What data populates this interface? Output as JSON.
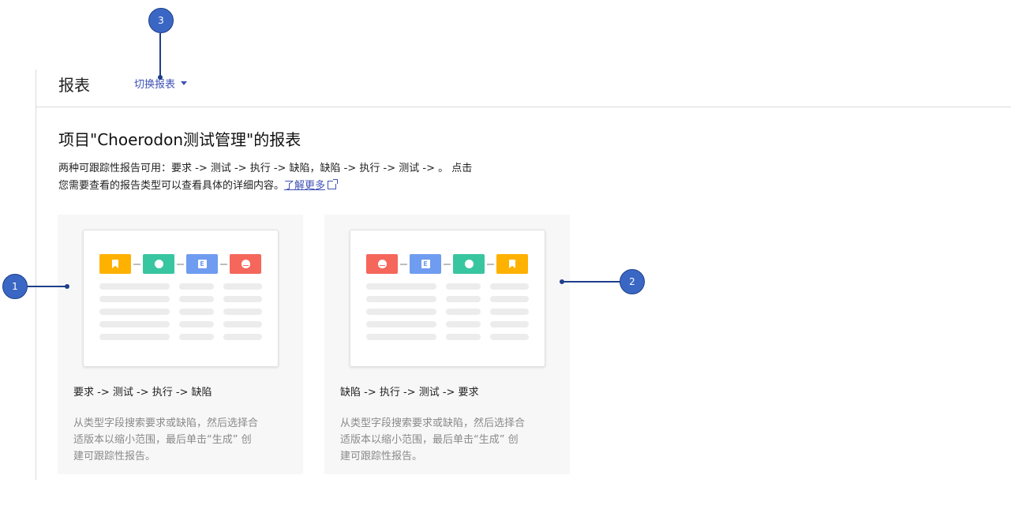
{
  "header": {
    "title": "报表",
    "switch_label": "切换报表"
  },
  "intro": {
    "heading": "项目\"Choerodon测试管理\"的报表",
    "line1": "两种可跟踪性报告可用：要求 -> 测试 -> 执行 -> 缺陷，缺陷 -> 执行 -> 测试 -> 。 点击",
    "line2": "您需要查看的报告类型可以查看具体的详细内容。",
    "learn_more": "了解更多"
  },
  "cards": [
    {
      "title": "要求 -> 测试 -> 执行 -> 缺陷",
      "desc_line1": "从类型字段搜索要求或缺陷，然后选择合",
      "desc_line2": "适版本以缩小范围，最后单击“生成” 创",
      "desc_line3": "建可跟踪性报告。",
      "chips": [
        "bookmark-icon",
        "compass-icon",
        "execution-icon",
        "bug-icon"
      ]
    },
    {
      "title": "缺陷 -> 执行 -> 测试 -> 要求",
      "desc_line1": "从类型字段搜索要求或缺陷，然后选择合",
      "desc_line2": "适版本以缩小范围，最后单击“生成” 创",
      "desc_line3": "建可跟踪性报告。",
      "chips": [
        "bug-icon",
        "execution-icon",
        "compass-icon",
        "bookmark-icon"
      ]
    }
  ],
  "callouts": {
    "one": "1",
    "two": "2",
    "three": "3"
  },
  "colors": {
    "accent": "#3f51b5",
    "chip_bookmark": "#ffb100",
    "chip_compass": "#38c6a0",
    "chip_execution": "#6f9cf0",
    "chip_bug": "#f5675b",
    "callout": "#3b67c4"
  }
}
